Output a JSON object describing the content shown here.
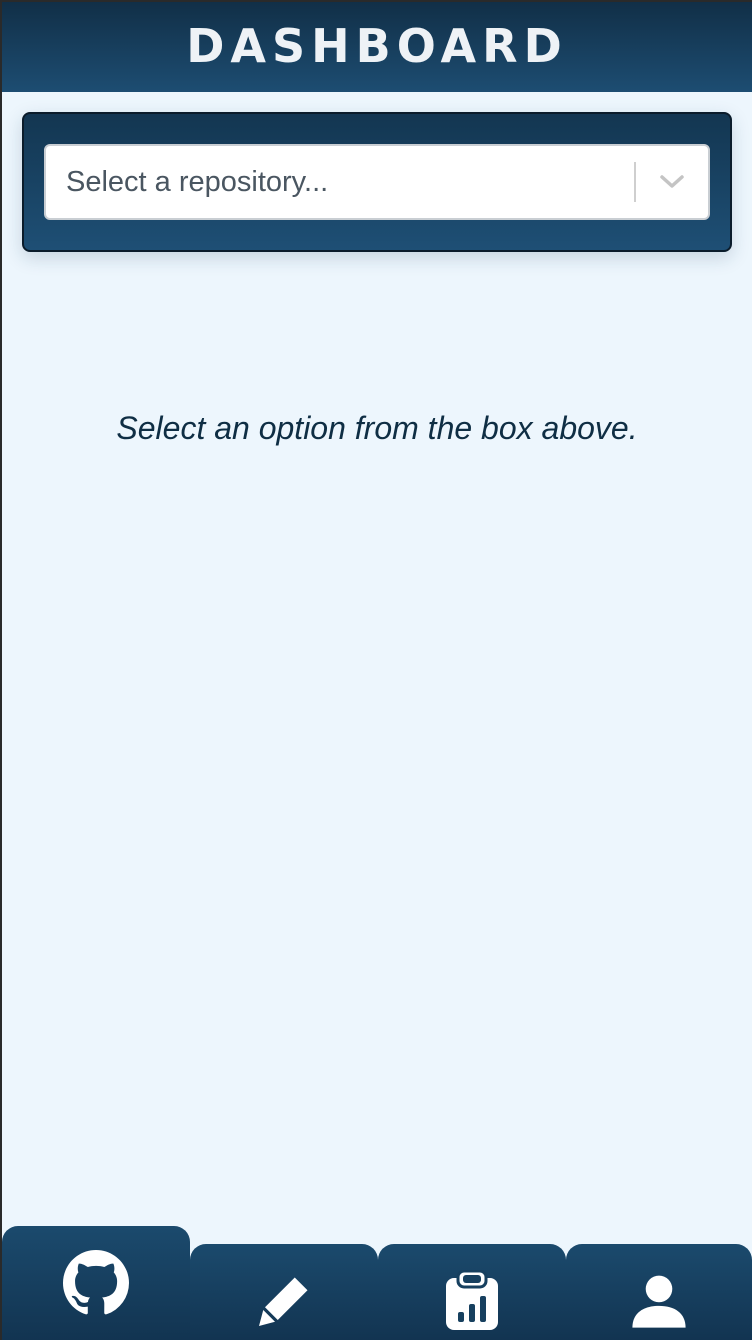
{
  "header": {
    "title": "DASHBOARD"
  },
  "repo_select": {
    "placeholder": "Select a repository...",
    "indicator_icon": "chevron-down-icon"
  },
  "main": {
    "hint": "Select an option from the box above."
  },
  "bottom_nav": {
    "active_tab": "github",
    "items": [
      {
        "id": "github",
        "icon": "github-icon"
      },
      {
        "id": "edit",
        "icon": "pencil-icon"
      },
      {
        "id": "report",
        "icon": "clipboard-chart-icon"
      },
      {
        "id": "profile",
        "icon": "user-icon"
      }
    ]
  },
  "colors": {
    "header_dark": "#112f47",
    "header_light": "#1d4d72",
    "page_background": "#edf6fd",
    "text_dark": "#0f2e44",
    "icon_light": "#ffffff"
  }
}
